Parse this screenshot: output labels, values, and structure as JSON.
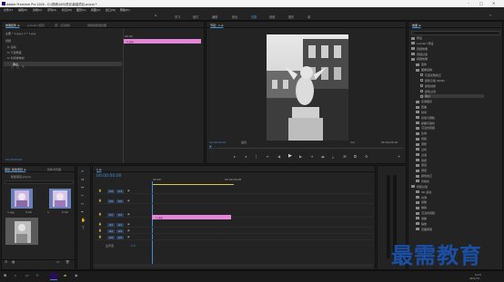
{
  "window": {
    "title": "Adobe Premiere Pro 2020 - D:\\视频\\005\\项目\\新建项目.prproj *"
  },
  "menu": [
    "文件(F)",
    "编辑(E)",
    "剪辑(C)",
    "序列(S)",
    "标记(M)",
    "图形(G)",
    "视图(V)",
    "窗口(W)",
    "帮助(H)"
  ],
  "workspace": {
    "tabs": [
      "学习",
      "组件",
      "编辑",
      "颜色",
      "效果",
      "音频",
      "图形",
      "库"
    ],
    "active_index": 4
  },
  "effect_controls": {
    "tabs": [
      "效果控件 ≡",
      "Lumetri 范围",
      "源：(无剪辑)",
      "音频剪辑混合器"
    ],
    "clip_header": "主要 * 1.jpg ▸ 1 * 1.jpg",
    "section": "视频",
    "props": [
      "fx  运动",
      "fx  不透明度",
      "fx  时间重映射"
    ],
    "fx_label": "黑白",
    "clip_label": "1.jpg",
    "ruler_time": "00:00"
  },
  "program": {
    "tab": "节目：1 ≡",
    "timecode_left": "00:00:00:00",
    "fit": "适合",
    "resolution": "1/2",
    "timecode_right": "00:00:05:00"
  },
  "project": {
    "tabs": [
      "项目: 新建项目 ≡",
      "媒体浏览器"
    ],
    "file": "新建项目.prproj",
    "items": [
      {
        "name": "1.jpg",
        "duration": "5:00"
      },
      {
        "name": "1",
        "duration": "5:00"
      }
    ]
  },
  "timeline": {
    "tab": "1 ≡",
    "timecode": "00:00:00:00",
    "ruler": [
      "00:00",
      "00:00:05:00"
    ],
    "tracks": [
      {
        "name": "V3",
        "toggle": "V3"
      },
      {
        "name": "V2",
        "toggle": "V2"
      },
      {
        "name": "V1",
        "toggle": "V1"
      },
      {
        "name": "A1",
        "toggle": "A1"
      },
      {
        "name": "A2",
        "toggle": "A2"
      },
      {
        "name": "A3",
        "toggle": "A3"
      }
    ],
    "master_label": "主声道",
    "master_value": "0.0",
    "clip_label": "1.jpg"
  },
  "effects_panel": {
    "tab": "效果 ≡",
    "tree": [
      {
        "label": "预设",
        "indent": 0,
        "kind": "fold"
      },
      {
        "label": "Lumetri 预设",
        "indent": 0,
        "kind": "fold"
      },
      {
        "label": "音频效果",
        "indent": 0,
        "kind": "fold"
      },
      {
        "label": "音频过渡",
        "indent": 0,
        "kind": "fold"
      },
      {
        "label": "视频效果",
        "indent": 0,
        "kind": "fold"
      },
      {
        "label": "变换",
        "indent": 1,
        "kind": "fold"
      },
      {
        "label": "图像控制",
        "indent": 1,
        "kind": "fold"
      },
      {
        "label": "灰度系数校正",
        "indent": 2,
        "kind": "file"
      },
      {
        "label": "颜色平衡 (RGB)",
        "indent": 2,
        "kind": "file"
      },
      {
        "label": "颜色替换",
        "indent": 2,
        "kind": "file"
      },
      {
        "label": "颜色过滤",
        "indent": 2,
        "kind": "file"
      },
      {
        "label": "黑白",
        "indent": 2,
        "kind": "file",
        "selected": true
      },
      {
        "label": "实用程序",
        "indent": 1,
        "kind": "fold"
      },
      {
        "label": "扭曲",
        "indent": 1,
        "kind": "fold"
      },
      {
        "label": "时间",
        "indent": 1,
        "kind": "fold"
      },
      {
        "label": "杂色与颗粒",
        "indent": 1,
        "kind": "fold"
      },
      {
        "label": "模糊与锐化",
        "indent": 1,
        "kind": "fold"
      },
      {
        "label": "沉浸式视频",
        "indent": 1,
        "kind": "fold"
      },
      {
        "label": "生成",
        "indent": 1,
        "kind": "fold"
      },
      {
        "label": "视频",
        "indent": 1,
        "kind": "fold"
      },
      {
        "label": "调整",
        "indent": 1,
        "kind": "fold"
      },
      {
        "label": "过时",
        "indent": 1,
        "kind": "fold"
      },
      {
        "label": "过渡",
        "indent": 1,
        "kind": "fold"
      },
      {
        "label": "透视",
        "indent": 1,
        "kind": "fold"
      },
      {
        "label": "通道",
        "indent": 1,
        "kind": "fold"
      },
      {
        "label": "键控",
        "indent": 1,
        "kind": "fold"
      },
      {
        "label": "颜色校正",
        "indent": 1,
        "kind": "fold"
      },
      {
        "label": "风格化",
        "indent": 1,
        "kind": "fold"
      },
      {
        "label": "视频过渡",
        "indent": 0,
        "kind": "fold"
      },
      {
        "label": "3D 运动",
        "indent": 1,
        "kind": "fold"
      },
      {
        "label": "内滑",
        "indent": 1,
        "kind": "fold"
      },
      {
        "label": "划像",
        "indent": 1,
        "kind": "fold"
      },
      {
        "label": "擦除",
        "indent": 1,
        "kind": "fold"
      },
      {
        "label": "沉浸式视频",
        "indent": 1,
        "kind": "fold"
      },
      {
        "label": "溶解",
        "indent": 1,
        "kind": "fold"
      },
      {
        "label": "缩放",
        "indent": 1,
        "kind": "fold"
      },
      {
        "label": "页面剥落",
        "indent": 1,
        "kind": "fold"
      }
    ]
  },
  "tray": {
    "time": "9:23",
    "date": "2021/7/1"
  },
  "watermark": "最需教育",
  "colors": {
    "accent": "#3d8ed8",
    "clip": "#e486d7"
  }
}
